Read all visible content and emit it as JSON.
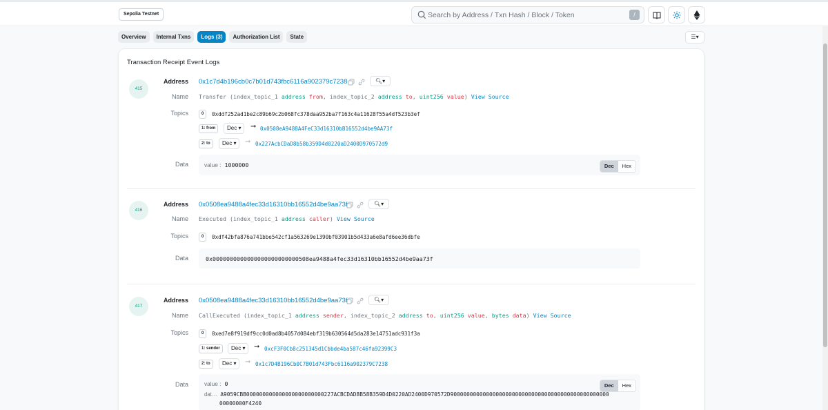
{
  "header": {
    "network": "Sepolia Testnet",
    "search_placeholder": "Search by Address / Txn Hash / Block / Token",
    "slash": "/"
  },
  "tabs": [
    {
      "label": "Overview",
      "active": false
    },
    {
      "label": "Internal Txns",
      "active": false
    },
    {
      "label": "Logs (3)",
      "active": true
    },
    {
      "label": "Authorization List",
      "active": false
    },
    {
      "label": "State",
      "active": false
    }
  ],
  "card": {
    "title": "Transaction Receipt Event Logs"
  },
  "labels": {
    "address": "Address",
    "name": "Name",
    "topics": "Topics",
    "data": "Data",
    "dec": "Dec",
    "hex": "Hex",
    "view_source": "View Source"
  },
  "logs": [
    {
      "index": "415",
      "address": "0x1c7d4b196cb0c7b01d743fbc6116a902379c7238",
      "name_fn": "Transfer",
      "topics": {
        "t0": "0xddf252ad1be2c89b69c2b068fc378daa952ba7f163c4a11628f55a4df523b3ef",
        "t1_badge": "1: from",
        "t1_fmt": "Dec",
        "t1_val": "0x0508eA9488A4FeC33d16310bB16552d4be9AA73f",
        "t2_badge": "2: to",
        "t2_fmt": "Dec",
        "t2_val": "0x227AcbCDaD8b58b359D4d0220aD2400D970572d9"
      },
      "data_label": "value :",
      "data_value": "1000000"
    },
    {
      "index": "416",
      "address": "0x0508ea9488a4fec33d16310bb16552d4be9aa73f",
      "name_fn": "Executed",
      "topics": {
        "t0": "0xdf42bfa876a741bbe542cf1a563269e1390bf03901b5d433a6e8afd6ee36dbfe"
      },
      "data_value": "0x0000000000000000000000000508ea9488a4fec33d16310bb16552d4be9aa73f"
    },
    {
      "index": "417",
      "address": "0x0508ea9488a4fec33d16310bb16552d4be9aa73f",
      "name_fn": "CallExecuted",
      "topics": {
        "t0": "0xed7e8f919df9cc0d0ad8b4057d084ebf319b630564d5da283e14751adc931f3a",
        "t1_badge": "1: sender",
        "t1_fmt": "Dec",
        "t1_val": "0xcF3F0Cb8c251345d1Cbbde4ba587c46fa92399C3",
        "t2_badge": "2: to",
        "t2_fmt": "Dec",
        "t2_val": "0x1c7D4B196Cb0C7B01d743Fbc6116a902379C7238"
      },
      "data_label": "value :",
      "data_value": "0",
      "data_label2": "dat…",
      "data_line2": "A9059CBB000000000000000000000000227ACBCDAD8B58B359D4D0220AD2400D970572D9000000000000000000000000000000000000000000000000",
      "data_line3": "00000000F4240"
    }
  ]
}
